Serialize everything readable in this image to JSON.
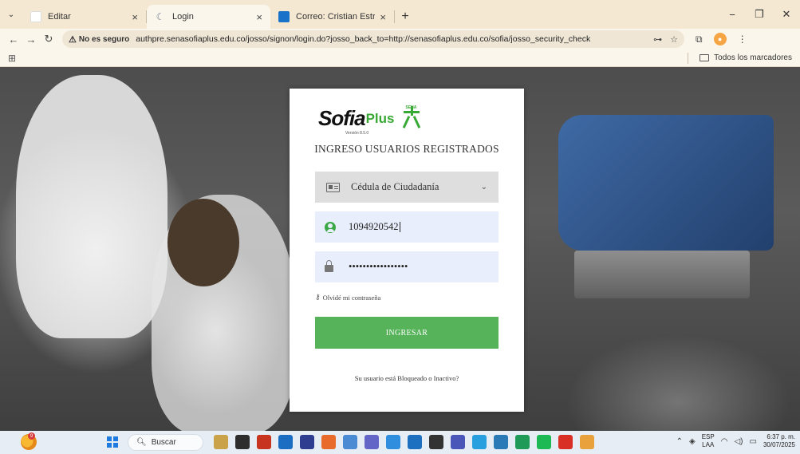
{
  "browser": {
    "tabs": [
      {
        "title": "Editar",
        "active": false
      },
      {
        "title": "Login",
        "active": true
      },
      {
        "title": "Correo: Cristian Estrada Betanc",
        "active": false
      }
    ],
    "security_label": "No es seguro",
    "url": "authpre.senasofiaplus.edu.co/josso/signon/login.do?josso_back_to=http://senasofiaplus.edu.co/sofia/josso_security_check",
    "bookmarks_all_label": "Todos los marcadores"
  },
  "login": {
    "logo_main": "Sofia",
    "logo_plus": "Plus",
    "logo_version": "Versión 8.5.0",
    "sena_label": "SENA",
    "title": "INGRESO USUARIOS REGISTRADOS",
    "document_type": "Cédula de Ciudadanía",
    "username_value": "1094920542",
    "password_value": "•••••••••••••••••",
    "forgot_label": "Olvidé mi contraseña",
    "submit_label": "INGRESAR",
    "blocked_label": "Su usuario está Bloqueado o Inactivo?"
  },
  "taskbar": {
    "search_label": "Buscar",
    "weather_badge": "9",
    "lang_top": "ESP",
    "lang_bottom": "LAA",
    "time": "6:37 p. m.",
    "date": "30/07/2025",
    "app_colors": [
      "#c9a24a",
      "#2d2d2d",
      "#c7341f",
      "#1b6ec2",
      "#2e3d8f",
      "#e86b2b",
      "#4b8bd4",
      "#6466c7",
      "#2f8fde",
      "#1d6fc0",
      "#333333",
      "#4b57b8",
      "#28a0e0",
      "#2a7ab8",
      "#1f9a57",
      "#1db954",
      "#d93025",
      "#e9a23b"
    ]
  }
}
